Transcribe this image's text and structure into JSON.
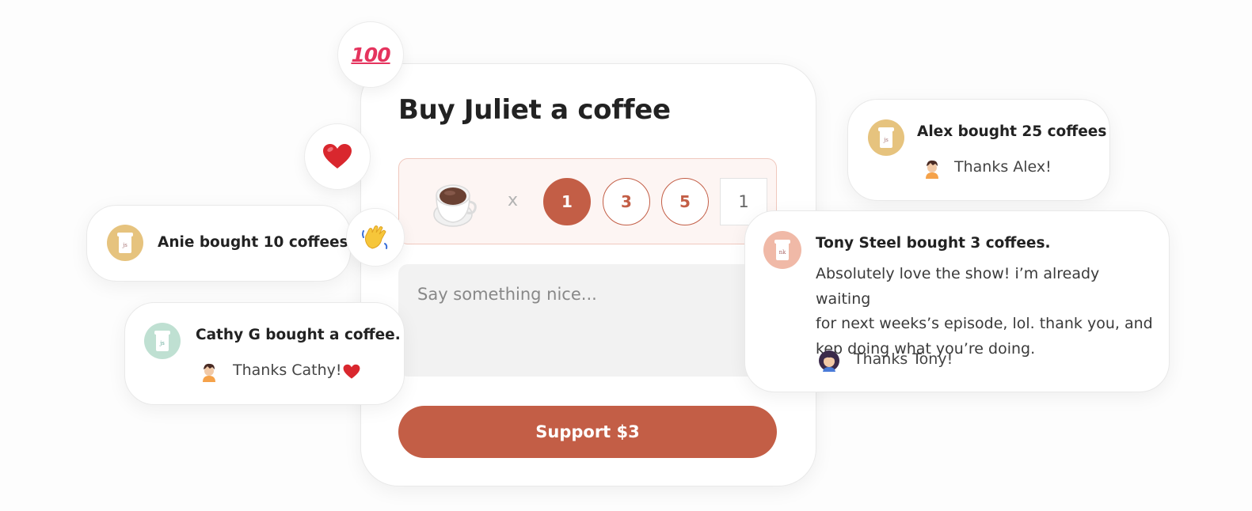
{
  "main": {
    "title": "Buy Juliet a coffee",
    "multiplier": "x",
    "quantities": [
      "1",
      "3",
      "5"
    ],
    "selected_quantity": "1",
    "custom_quantity": "1",
    "message_placeholder": "Say something nice...",
    "support_label": "Support $3"
  },
  "reaction_bubbles": {
    "hundred": "100",
    "heart_icon": "heart-icon",
    "wave_icon": "waving-hand-icon"
  },
  "notifications": {
    "alex": {
      "title": "Alex bought 25 coffees",
      "reply": "Thanks Alex!"
    },
    "anie": {
      "title": "Anie bought 10 coffees"
    },
    "cathy": {
      "title": "Cathy G bought a coffee.",
      "reply": "Thanks Cathy!"
    },
    "tony": {
      "title": "Tony Steel bought 3 coffees.",
      "body_lines": [
        "Absolutely love the show! i’m already waiting",
        "for next weeks’s episode, lol. thank you, and",
        "kep doing what you’re doing."
      ],
      "reply": "Thanks Tony!"
    }
  },
  "colors": {
    "accent": "#c35e46",
    "selector_bg": "#fdf5f3",
    "cup_gold": "#e6c37e",
    "cup_mint": "#bfe0d2",
    "cup_peach": "#f0b9a7"
  }
}
